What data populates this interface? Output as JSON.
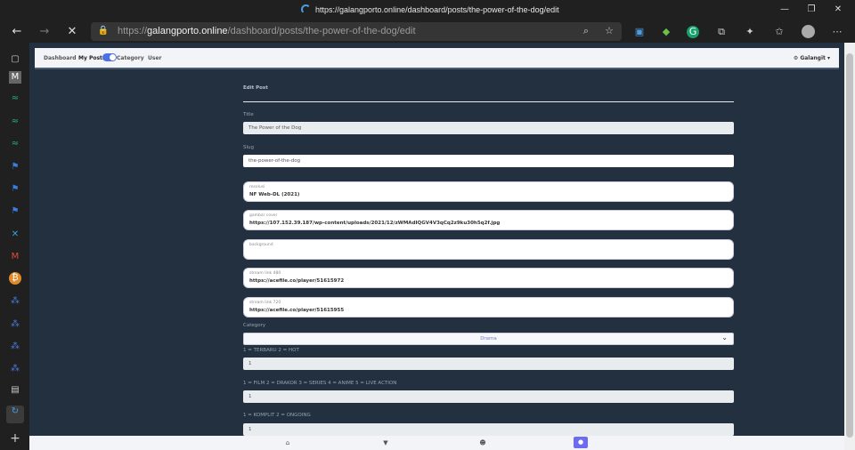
{
  "browser": {
    "tab_title": "https://galangporto.online/dashboard/posts/the-power-of-the-dog/edit",
    "url_host": "galangporto.online",
    "url_prefix": "https://",
    "url_path": "/dashboard/posts/the-power-of-the-dog/edit"
  },
  "nav": {
    "dashboard": "Dashboard",
    "my_posts": "My Posts",
    "category": "Category",
    "user": "User",
    "user_menu": "⚙ Galangit ▾"
  },
  "form": {
    "heading": "Edit Post",
    "title_label": "Title",
    "title_value": "The Power of the Dog",
    "slug_label": "Slug",
    "slug_value": "the-power-of-the-dog",
    "resolusi_label": "resolusi",
    "resolusi_value": "NF Web-DL (2021)",
    "cover_label": "gambar cover",
    "cover_value": "https://107.152.39.187/wp-content/uploads/2021/12/zWMAdIQGV4V3qCq2z9ku30h5q2f.jpg",
    "background_label": "background",
    "background_value": "",
    "stream480_label": "stream link 480",
    "stream480_value": "https://acefile.co/player/51615972",
    "stream720_label": "stream link 720",
    "stream720_value": "https://acefile.co/player/51615955",
    "category_label": "Category",
    "category_value": "Drama",
    "terbaru_label": "1 = TERBARU 2 = HOT",
    "terbaru_value": "1",
    "type_label": "1 = FILM 2 = DRAKOR 3 = SERIES 4 = ANIME 5 = LIVE ACTION",
    "type_value": "1",
    "status_label": "1 = KOMPLIT 2 = ONGOING",
    "status_value": "1"
  },
  "bottom_nav": [
    "home-icon",
    "filter-icon",
    "users-icon",
    "account-icon"
  ],
  "colors": {
    "page_bg": "#22303f",
    "accent": "#6c6cf0",
    "toggle": "#4d6fe6"
  }
}
